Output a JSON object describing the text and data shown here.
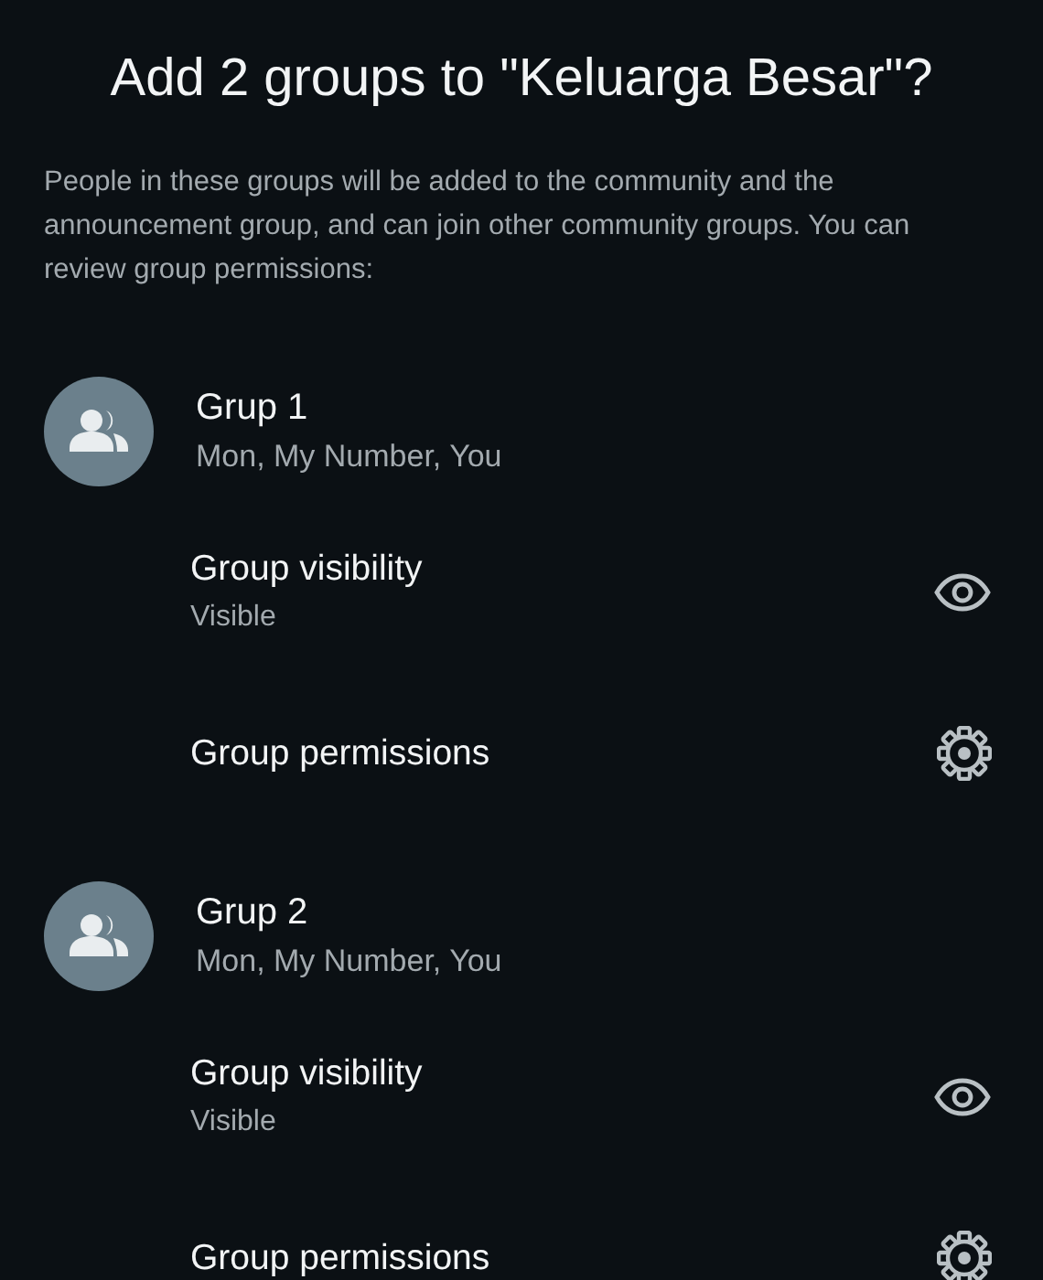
{
  "title": "Add 2 groups to \"Keluarga Besar\"?",
  "description": "People in these groups will be added to the community and the announcement group, and can join other community groups. You can review group permissions:",
  "groups": [
    {
      "name": "Grup 1",
      "members": "Mon, My Number, You",
      "settings": [
        {
          "kind": "visibility",
          "title": "Group visibility",
          "value": "Visible"
        },
        {
          "kind": "permissions",
          "title": "Group permissions"
        }
      ]
    },
    {
      "name": "Grup 2",
      "members": "Mon, My Number, You",
      "settings": [
        {
          "kind": "visibility",
          "title": "Group visibility",
          "value": "Visible"
        },
        {
          "kind": "permissions",
          "title": "Group permissions"
        }
      ]
    }
  ]
}
